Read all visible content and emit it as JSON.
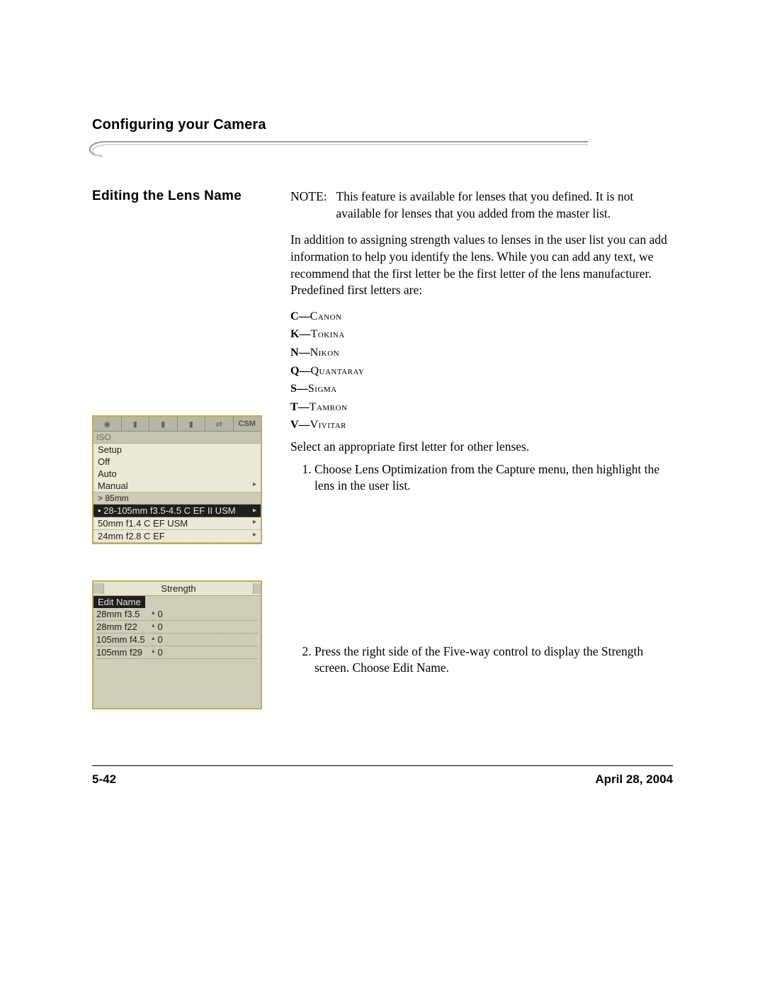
{
  "chapterTitle": "Configuring your Camera",
  "sectionTitle": "Editing the Lens Name",
  "note": {
    "label": "NOTE:",
    "text": "This feature is available for lenses that you defined. It is not available for lenses that you added from the master list."
  },
  "intro": "In addition to assigning strength values to lenses in the user list you can add information to help you identify the lens. While you can add any text, we recommend that the first letter be the first letter of the lens manufacturer. Predefined first letters are:",
  "manufacturers": [
    {
      "letter": "C",
      "name": "Canon"
    },
    {
      "letter": "K",
      "name": "Tokina"
    },
    {
      "letter": "N",
      "name": "Nikon"
    },
    {
      "letter": "Q",
      "name": "Quantaray"
    },
    {
      "letter": "S",
      "name": "Sigma"
    },
    {
      "letter": "T",
      "name": "Tamron"
    },
    {
      "letter": "V",
      "name": "Vivitar"
    }
  ],
  "selectOther": "Select an appropriate first letter for other lenses.",
  "steps": [
    "Choose Lens Optimization from the Capture menu, then highlight the lens in the user list.",
    "Press the right side of the Five-way control to display the Strength screen. Choose Edit Name."
  ],
  "lcd1": {
    "csm": "CSM",
    "iso": "ISO",
    "rows": [
      {
        "text": "Setup",
        "type": "plain"
      },
      {
        "text": "Off",
        "type": "plain"
      },
      {
        "text": "Auto",
        "type": "plain"
      },
      {
        "text": "Manual",
        "type": "dotted"
      },
      {
        "text": "> 85mm",
        "type": "div"
      },
      {
        "text": "28-105mm f3.5-4.5 C EF II USM",
        "type": "selected"
      },
      {
        "text": "50mm f1.4 C EF USM",
        "type": "dotted"
      },
      {
        "text": "24mm f2.8 C EF",
        "type": "dotted"
      }
    ]
  },
  "lcd2": {
    "title": "Strength",
    "selected": "Edit Name",
    "rows": [
      {
        "label": "28mm f3.5",
        "val": "0"
      },
      {
        "label": "28mm f22",
        "val": "0"
      },
      {
        "label": "105mm f4.5",
        "val": "0"
      },
      {
        "label": "105mm f29",
        "val": "0"
      }
    ]
  },
  "footer": {
    "page": "5-42",
    "date": "April 28, 2004"
  }
}
